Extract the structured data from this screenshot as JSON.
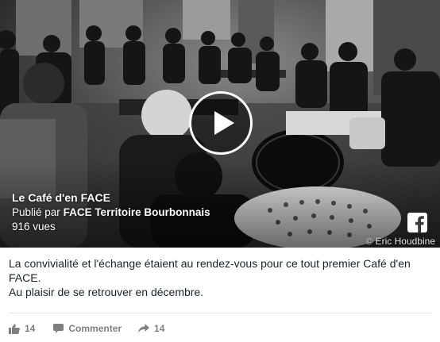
{
  "video": {
    "title": "Le Café d'en FACE",
    "published_prefix": "Publié par",
    "publisher": "FACE Territoire Bourbonnais",
    "views": "916 vues",
    "photo_credit": "© Eric Houdbine",
    "play_icon": "play-icon",
    "brand_icon": "facebook-icon"
  },
  "post": {
    "text_line1": "La convivialité et l'échange étaient au rendez-vous pour ce tout premier Café d'en FACE.",
    "text_line2": "Au plaisir de se retrouver en décembre."
  },
  "actions": {
    "likes_count": "14",
    "comment_label": "Commenter",
    "shares_count": "14"
  },
  "colors": {
    "text": "#1d2129",
    "muted": "#7f7f7f",
    "divider": "#e5e5e5"
  }
}
